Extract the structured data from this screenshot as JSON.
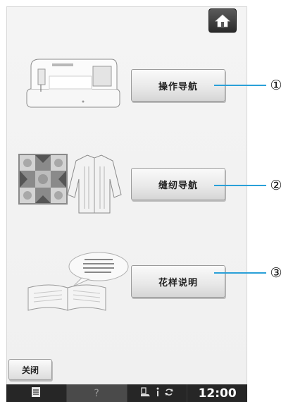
{
  "menu": {
    "items": [
      {
        "label": "操作导航",
        "callout": "①"
      },
      {
        "label": "缝纫导航",
        "callout": "②"
      },
      {
        "label": "花样说明",
        "callout": "③"
      }
    ]
  },
  "close_label": "关闭",
  "status_bar": {
    "time": "12:00",
    "help_glyph": "?"
  },
  "icons": [
    "home-icon",
    "document-icon",
    "help-icon",
    "presser-foot-icon",
    "info-icon",
    "rotate-icon"
  ]
}
